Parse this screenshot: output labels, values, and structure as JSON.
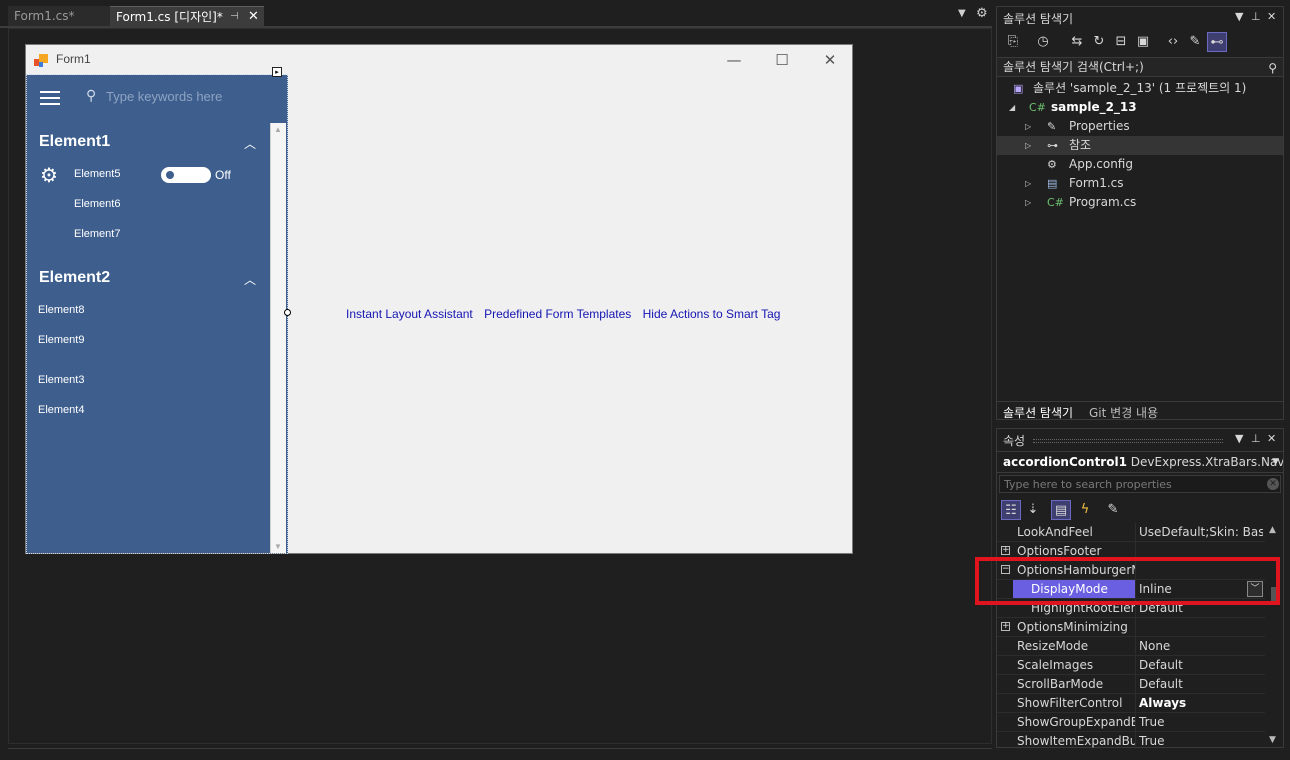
{
  "doc_tabs": [
    {
      "label": "Form1.cs*"
    },
    {
      "label": "Form1.cs [디자인]*"
    }
  ],
  "form": {
    "title": "Form1",
    "search_placeholder": "Type keywords here",
    "toggle_text": "Off",
    "groups": [
      {
        "label": "Element1",
        "items": [
          "Element5",
          "Element6",
          "Element7"
        ]
      },
      {
        "label": "Element2",
        "items": [
          "Element8",
          "Element9"
        ]
      }
    ],
    "loose_items": [
      "Element3",
      "Element4"
    ],
    "designer_links": [
      "Instant Layout Assistant",
      "Predefined Form Templates",
      "Hide Actions to Smart Tag"
    ]
  },
  "solution_explorer": {
    "title": "솔루션 탐색기",
    "search_placeholder": "솔루션 탐색기 검색(Ctrl+;)",
    "tree": [
      {
        "label": "솔루션 'sample_2_13' (1 프로젝트의 1)"
      },
      {
        "label": "sample_2_13"
      },
      {
        "label": "Properties"
      },
      {
        "label": "참조"
      },
      {
        "label": "App.config"
      },
      {
        "label": "Form1.cs"
      },
      {
        "label": "Program.cs"
      }
    ],
    "bottom_tabs": [
      "솔루션 탐색기",
      "Git 변경 내용"
    ]
  },
  "properties": {
    "title": "속성",
    "object_name": "accordionControl1",
    "object_type": "DevExpress.XtraBars.Navigati",
    "search_placeholder": "Type here to search properties",
    "rows": [
      {
        "name": "LookAndFeel",
        "value": "UseDefault;Skin: Basic"
      },
      {
        "name": "OptionsFooter",
        "value": ""
      },
      {
        "name": "OptionsHamburgerMe",
        "value": ""
      },
      {
        "name": "DisplayMode",
        "value": "Inline"
      },
      {
        "name": "HighlightRootEleme",
        "value": "Default"
      },
      {
        "name": "OptionsMinimizing",
        "value": ""
      },
      {
        "name": "ResizeMode",
        "value": "None"
      },
      {
        "name": "ScaleImages",
        "value": "Default"
      },
      {
        "name": "ScrollBarMode",
        "value": "Default"
      },
      {
        "name": "ShowFilterControl",
        "value": "Always"
      },
      {
        "name": "ShowGroupExpandBu",
        "value": "True"
      },
      {
        "name": "ShowItemExpandButto",
        "value": "True"
      }
    ]
  },
  "colors": {
    "ide_bg": "#1f1f1f",
    "accordion_bg": "#3e5f8e",
    "selection": "#6a5fe0",
    "highlight_box": "#e0141e",
    "link": "#1515b3"
  }
}
